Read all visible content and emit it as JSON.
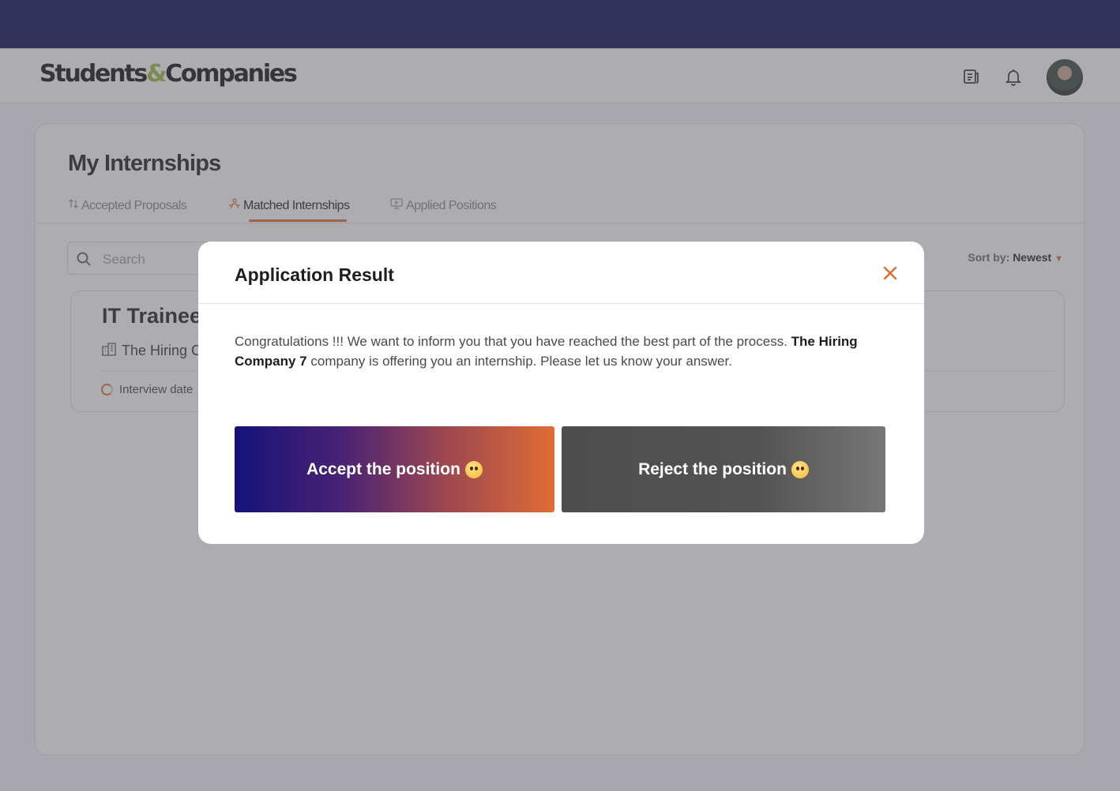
{
  "app": {
    "logo_left": "Students",
    "logo_amp": "&",
    "logo_right": "Companies",
    "colors": {
      "topbar": "#0c0a52",
      "accent": "#e06b2e",
      "logo_amp": "#9bbd3f"
    }
  },
  "header": {
    "icons": [
      "news-icon",
      "bell-icon",
      "avatar"
    ]
  },
  "page": {
    "title": "My Internships",
    "tabs": [
      {
        "label": "Accepted Proposals",
        "icon": "swap-arrows-icon",
        "active": false
      },
      {
        "label": "Matched Internships",
        "icon": "handshake-icon",
        "active": true
      },
      {
        "label": "Applied Positions",
        "icon": "presentation-icon",
        "active": false
      }
    ],
    "search": {
      "placeholder": "Search"
    },
    "sort": {
      "label": "Sort by:",
      "value": "Newest"
    }
  },
  "internship": {
    "title": "IT Trainee",
    "company": "The Hiring Co",
    "date_label": "Interview date"
  },
  "modal": {
    "title": "Application Result",
    "body_start": "Congratulations !!! We want to inform you that you have reached the best part of the process. ",
    "company": "The Hiring Company 7",
    "body_end": " company is offering you an internship. Please let us know your answer.",
    "accept_label": "Accept the position",
    "reject_label": "Reject the position"
  }
}
